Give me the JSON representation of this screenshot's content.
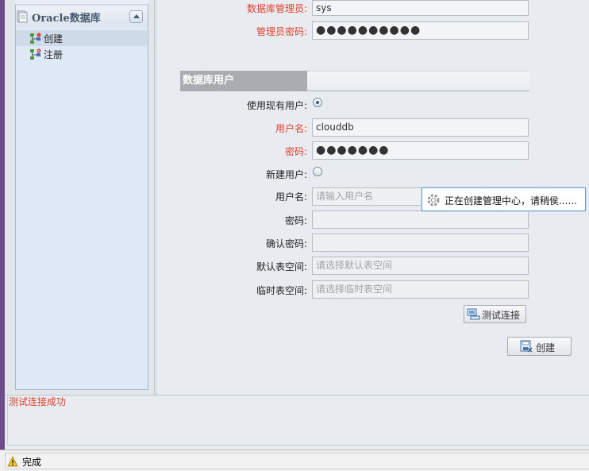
{
  "sidebar": {
    "title": "Oracle数据库",
    "items": [
      {
        "label": "创建",
        "selected": true
      },
      {
        "label": "注册",
        "selected": false
      }
    ]
  },
  "form": {
    "dba": {
      "label": "数据库管理员:",
      "value": "sys"
    },
    "dba_password": {
      "label": "管理员密码:",
      "value": "●●●●●●●●●●"
    },
    "section_title": "数据库用户",
    "use_existing": {
      "label": "使用现有用户:",
      "checked": true
    },
    "existing_user": {
      "label": "用户名:",
      "value": "clouddb"
    },
    "existing_password": {
      "label": "密码:",
      "value": "●●●●●●●"
    },
    "new_user": {
      "label": "新建用户:",
      "checked": false
    },
    "new_username": {
      "label": "用户名:",
      "placeholder": "请输入用户名"
    },
    "new_password": {
      "label": "密码:"
    },
    "confirm_password": {
      "label": "确认密码:"
    },
    "default_tablespace": {
      "label": "默认表空间:",
      "placeholder": "请选择默认表空间"
    },
    "temp_tablespace": {
      "label": "临时表空间:",
      "placeholder": "请选择临时表空间"
    },
    "test_button": "测试连接",
    "create_button": "创建"
  },
  "toast": {
    "text": "正在创建管理中心，请稍侯......"
  },
  "log": {
    "message": "测试连接成功",
    "color": "#e0402b"
  },
  "statusbar": {
    "text": "完成"
  },
  "colors": {
    "required_label": "#e0402b",
    "section_header": "#a9acb0",
    "accent_purple": "#6d4c8a"
  }
}
